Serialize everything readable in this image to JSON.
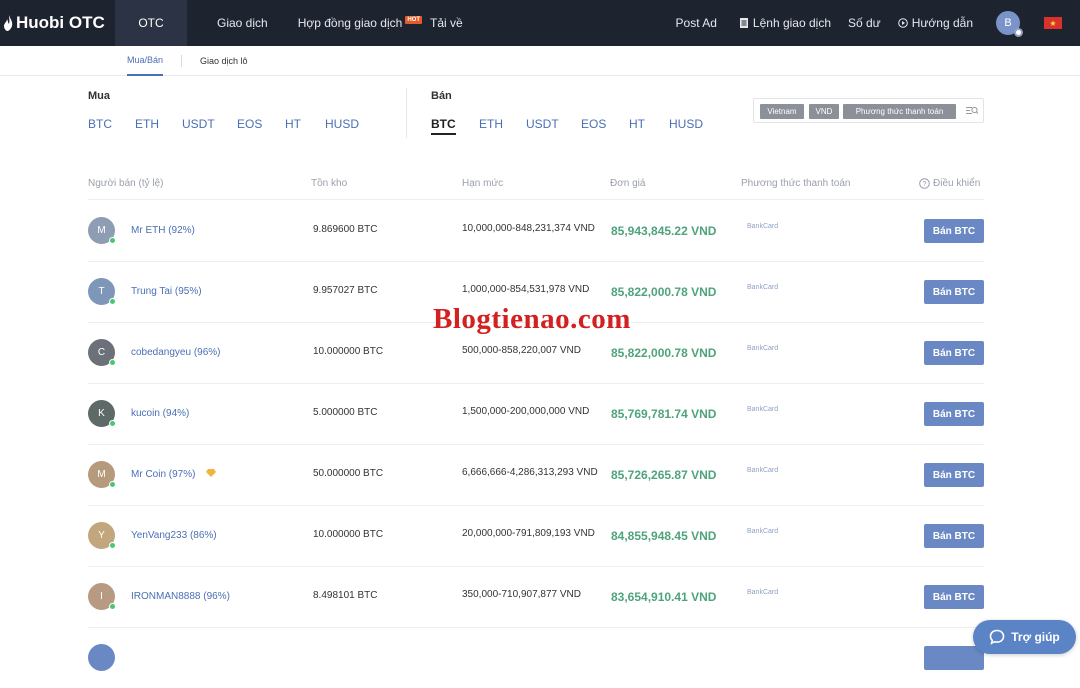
{
  "header": {
    "logo": "Huobi OTC",
    "nav_active": "OTC",
    "nav": [
      "Giao dịch",
      "Hợp đồng giao dịch",
      "Tải về"
    ],
    "hot_badge": "HOT",
    "right": {
      "post_ad": "Post Ad",
      "orders": "Lệnh giao dịch",
      "balance": "Số dư",
      "guide": "Hướng dẫn",
      "avatar_letter": "B"
    }
  },
  "subnav": {
    "tab1": "Mua/Bán",
    "tab2": "Giao dịch lô"
  },
  "buy": {
    "label": "Mua",
    "coins": [
      "BTC",
      "ETH",
      "USDT",
      "EOS",
      "HT",
      "HUSD"
    ]
  },
  "sell": {
    "label": "Bán",
    "coins": [
      "BTC",
      "ETH",
      "USDT",
      "EOS",
      "HT",
      "HUSD"
    ],
    "active": "BTC"
  },
  "filter": {
    "country": "Vietnam",
    "currency": "VND",
    "method": "Phương thức thanh toán"
  },
  "table": {
    "headers": {
      "seller": "Người bán (tỷ lệ)",
      "stock": "Tồn kho",
      "limit": "Hạn mức",
      "price": "Đơn giá",
      "payment": "Phương thức thanh toán",
      "action": "Điều khiển"
    },
    "rows": [
      {
        "initial": "M",
        "name": "Mr ETH (92%)",
        "stock": "9.869600 BTC",
        "limit": "10,000,000-848,231,374 VND",
        "price": "85,943,845.22 VND",
        "payment": "BankCard",
        "button": "Bán BTC",
        "avatar_color": "#8e9db3"
      },
      {
        "initial": "T",
        "name": "Trung Tai (95%)",
        "stock": "9.957027 BTC",
        "limit": "1,000,000-854,531,978 VND",
        "price": "85,822,000.78 VND",
        "payment": "BankCard",
        "button": "Bán BTC",
        "avatar_color": "#7e96b8"
      },
      {
        "initial": "C",
        "name": "cobedangyeu (96%)",
        "stock": "10.000000 BTC",
        "limit": "500,000-858,220,007 VND",
        "price": "85,822,000.78 VND",
        "payment": "BankCard",
        "button": "Bán BTC",
        "avatar_color": "#6c7078"
      },
      {
        "initial": "K",
        "name": "kucoin (94%)",
        "stock": "5.000000 BTC",
        "limit": "1,500,000-200,000,000 VND",
        "price": "85,769,781.74 VND",
        "payment": "BankCard",
        "button": "Bán BTC",
        "avatar_color": "#5d6a68"
      },
      {
        "initial": "M",
        "name": "Mr Coin (97%)",
        "stock": "50.000000 BTC",
        "limit": "6,666,666-4,286,313,293 VND",
        "price": "85,726,265.87 VND",
        "payment": "BankCard",
        "button": "Bán BTC",
        "avatar_color": "#b59a7c"
      },
      {
        "initial": "Y",
        "name": "YenVang233 (86%)",
        "stock": "10.000000 BTC",
        "limit": "20,000,000-791,809,193 VND",
        "price": "84,855,948.45 VND",
        "payment": "BankCard",
        "button": "Bán BTC",
        "avatar_color": "#c2a77e"
      },
      {
        "initial": "I",
        "name": "IRONMAN8888 (96%)",
        "stock": "8.498101 BTC",
        "limit": "350,000-710,907,877 VND",
        "price": "83,654,910.41 VND",
        "payment": "BankCard",
        "button": "Bán BTC",
        "avatar_color": "#b89a82"
      }
    ]
  },
  "watermark": "Blogtienao.com",
  "help": "Trợ giúp",
  "colors": {
    "accent": "#4a6fb5",
    "price": "#4fa37b",
    "button": "#6a89c4",
    "topbar": "#1e2330"
  }
}
